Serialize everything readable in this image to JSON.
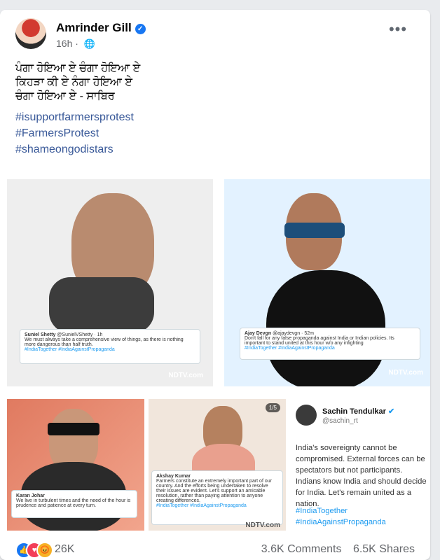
{
  "post": {
    "author": "Amrinder Gill",
    "time": "16h",
    "visibility_icon": "globe-icon",
    "text_lines": [
      "ਪੰਗਾ ਹੋਇਆ ਏ ਚੰਗਾ ਹੋਇਆ ਏ",
      "ਕਿਹੜਾ ਕੀ ਏ ਨੰਗਾ ਹੋਇਆ ਏ",
      "ਚੰਗਾ ਹੋਇਆ ਏ  - ਸਾਬਿਰ"
    ],
    "hashtags": [
      "#isupportfarmersprotest",
      "#FarmersProtest",
      "#shameongodistars"
    ]
  },
  "media": {
    "tile1": {
      "tweet_author": "Suniel Shetty",
      "tweet_handle": "@SunielVShetty · 1h",
      "tweet_text": "We must always take a comprehensive view of things, as there is nothing more dangerous than half truth.",
      "tweet_tags": "#IndiaTogether #IndiaAgainstPropaganda",
      "brand": "NDTV.com"
    },
    "tile2": {
      "tweet_author": "Ajay Devgn",
      "tweet_handle": "@ajaydevgn · 52m",
      "tweet_text": "Don't fall for any false propaganda against India or Indian policies. Its important to stand united at this hour w/o any infighting",
      "tweet_tags": "#IndiaTogether #IndiaAgainstPropaganda",
      "brand": "NDTV.com"
    },
    "tile3": {
      "tweet_author": "Karan Johar",
      "tweet_text": "We live in turbulent times and the need of the hour is prudence and patience at every turn."
    },
    "tile4": {
      "counter": "1/5",
      "tweet_author": "Akshay Kumar",
      "tweet_text": "Farmers constitute an extremely important part of our country. And the efforts being undertaken to resolve their issues are evident. Let's support an amicable resolution, rather than paying attention to anyone creating differences.",
      "tweet_tags": "#IndiaTogether #IndiaAgainstPropaganda",
      "brand": "NDTV.com"
    },
    "tile5": {
      "author": "Sachin Tendulkar",
      "handle": "@sachin_rt",
      "text": "India's sovereignty cannot be compromised. External forces can be spectators but not participants. Indians know India and should decide for India. Let's remain united as a nation.",
      "tags": [
        "#IndiaTogether",
        "#IndiaAgainstPropaganda"
      ]
    }
  },
  "footer": {
    "reaction_count": "26K",
    "comments": "3.6K Comments",
    "shares": "6.5K Shares"
  },
  "colors": {
    "link": "#385898",
    "verified": "#1877f2",
    "twitter_blue": "#1d9bf0"
  }
}
